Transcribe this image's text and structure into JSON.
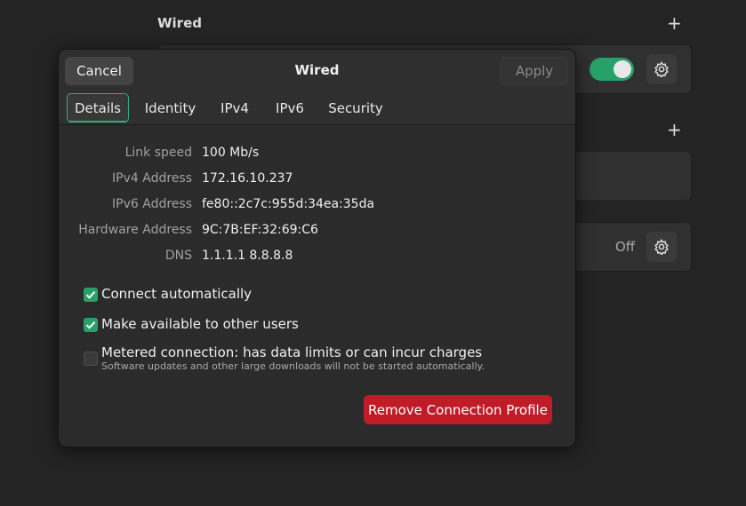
{
  "background": {
    "section_title": "Wired",
    "off_label": "Off"
  },
  "dialog": {
    "title": "Wired",
    "cancel_label": "Cancel",
    "apply_label": "Apply",
    "tabs": [
      {
        "label": "Details",
        "active": true
      },
      {
        "label": "Identity",
        "active": false
      },
      {
        "label": "IPv4",
        "active": false
      },
      {
        "label": "IPv6",
        "active": false
      },
      {
        "label": "Security",
        "active": false
      }
    ],
    "details": [
      {
        "label": "Link speed",
        "value": "100 Mb/s"
      },
      {
        "label": "IPv4 Address",
        "value": "172.16.10.237"
      },
      {
        "label": "IPv6 Address",
        "value": "fe80::2c7c:955d:34ea:35da"
      },
      {
        "label": "Hardware Address",
        "value": "9C:7B:EF:32:69:C6"
      },
      {
        "label": "DNS",
        "value": "1.1.1.1 8.8.8.8"
      }
    ],
    "options": {
      "connect_automatically": {
        "label": "Connect automatically",
        "checked": true
      },
      "available_to_others": {
        "label": "Make available to other users",
        "checked": true
      },
      "metered": {
        "label": "Metered connection: has data limits or can incur charges",
        "sublabel": "Software updates and other large downloads will not be started automatically.",
        "checked": false
      }
    },
    "remove_label": "Remove Connection Profile"
  },
  "colors": {
    "accent": "#26a269",
    "destructive": "#c01c28",
    "background": "#242424",
    "dialog": "#2b2b2b"
  }
}
